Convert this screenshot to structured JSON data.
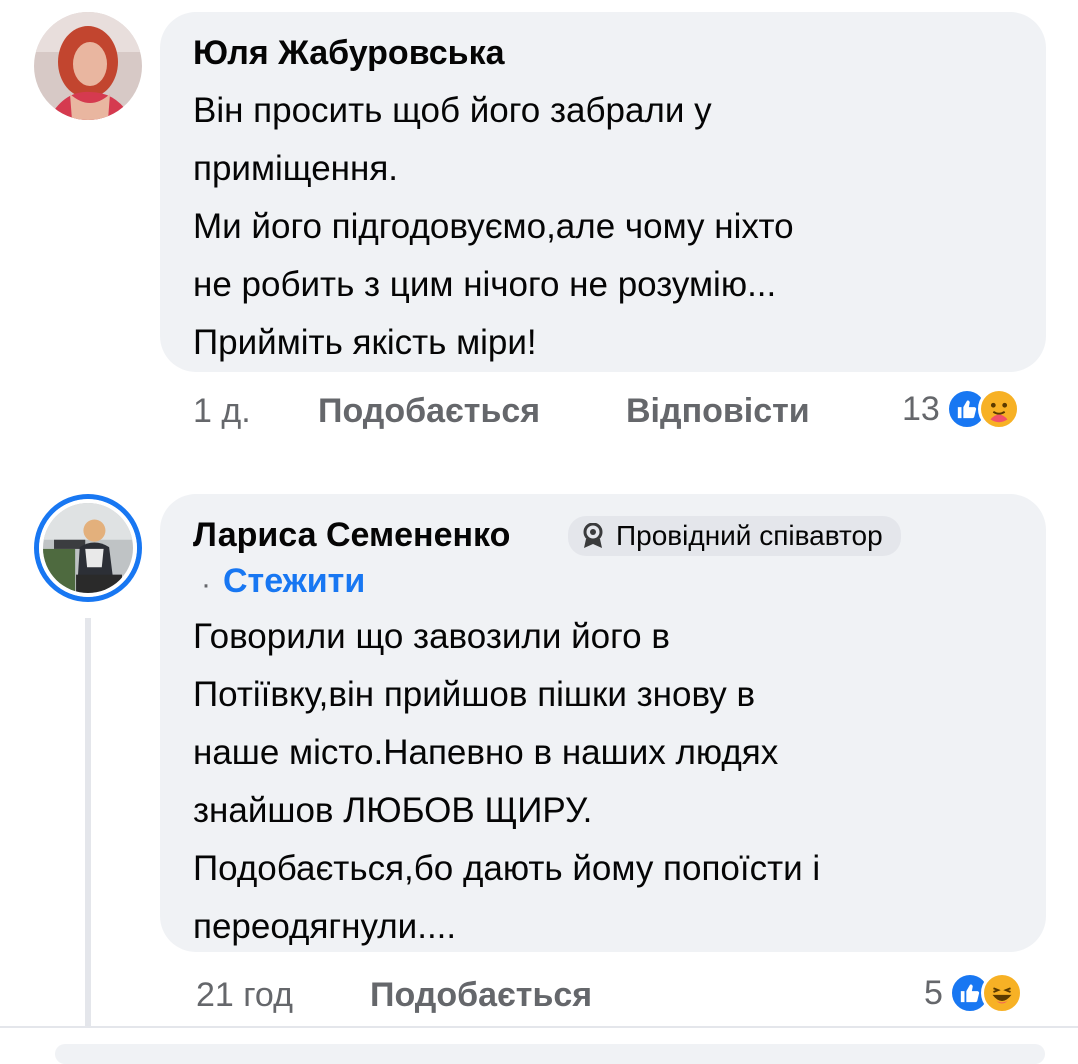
{
  "comments": [
    {
      "author": "Юля Жабуровська",
      "text": "Він просить щоб його забрали у\nприміщення.\nМи його підгодовуємо,але чому ніхто\nне робить з цим нічого не розумію...\nПрийміть якість міри!",
      "time": "1 д.",
      "like_label": "Подобається",
      "reply_label": "Відповісти",
      "reactions_count": "13",
      "reaction_icons": [
        "like-icon",
        "care-icon"
      ]
    },
    {
      "author": "Лариса Семененко",
      "badge": "Провідний співавтор",
      "follow_label": "Стежити",
      "follow_separator": "·",
      "text": "Говорили що завозили його в\nПотіївку,він прийшов пішки знову в\nнаше місто.Напевно в наших людях\nзнайшов ЛЮБОВ ЩИРУ.\nПодобається,бо дають йому попоїсти і\nпереодягнули....",
      "time": "21 год",
      "like_label": "Подобається",
      "reactions_count": "5",
      "reaction_icons": [
        "like-icon",
        "haha-icon"
      ]
    }
  ],
  "colors": {
    "bubble": "#f0f2f5",
    "meta": "#65676b",
    "link": "#1877f2",
    "like": "#1877f2",
    "emoji": "#f7b125"
  }
}
